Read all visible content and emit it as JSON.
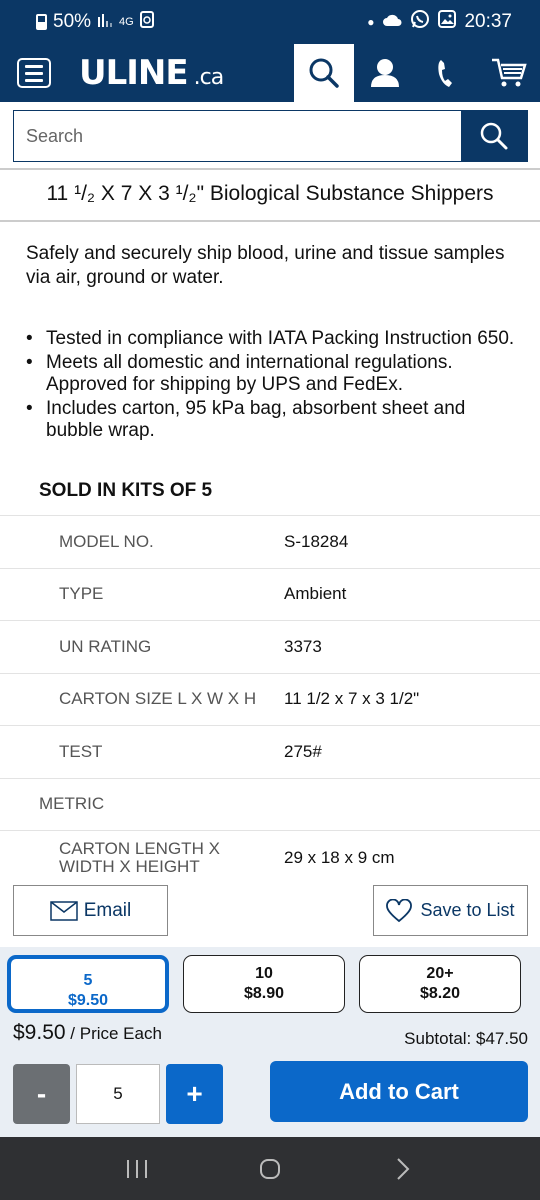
{
  "status_bar": {
    "battery": "50%",
    "signal": "4G",
    "time": "20:37",
    "icons": [
      "battery-icon",
      "signal-icon",
      "lte-icon",
      "notification-icon",
      "dot-icon",
      "cloud-icon",
      "whatsapp-icon",
      "gallery-icon"
    ]
  },
  "header": {
    "logo_main": "ULINE",
    "logo_suffix": ".ca",
    "icons": [
      "menu-icon",
      "search-icon",
      "account-icon",
      "phone-icon",
      "cart-icon"
    ],
    "brand_color": "#0b3765"
  },
  "search": {
    "placeholder": "Search"
  },
  "product": {
    "title": "11 ¹/₂ X 7 X 3 ¹/₂\" Biological Substance Shippers",
    "intro": "Safely and securely ship blood, urine and tissue samples via air, ground or water.",
    "bullets": [
      "Tested in compliance with IATA Packing Instruction 650.",
      "Meets all domestic and international regulations. Approved for shipping by UPS and FedEx.",
      "Includes carton, 95 kPa bag, absorbent sheet and bubble wrap."
    ],
    "sold_in": "SOLD IN KITS OF 5"
  },
  "specs": {
    "rows": [
      {
        "label": "MODEL NO.",
        "value": "S-18284"
      },
      {
        "label": "TYPE",
        "value": "Ambient"
      },
      {
        "label": "UN RATING",
        "value": "3373"
      },
      {
        "label": "CARTON SIZE L X W X H",
        "value": "11 1/2 x 7 x 3 1/2\""
      },
      {
        "label": "TEST",
        "value": "275#"
      }
    ],
    "metric_heading": "METRIC",
    "metric_rows": [
      {
        "label": "CARTON LENGTH X WIDTH X HEIGHT",
        "value": "29 x 18 x 9 cm"
      }
    ]
  },
  "actions": {
    "email_label": "Email",
    "save_label": "Save to List"
  },
  "cart": {
    "tiers": [
      {
        "qty": "5",
        "price": "$9.50",
        "selected": true
      },
      {
        "qty": "10",
        "price": "$8.90",
        "selected": false
      },
      {
        "qty": "20+",
        "price": "$8.20",
        "selected": false
      }
    ],
    "price_each_value": "$9.50",
    "price_each_label": " / Price Each",
    "subtotal": "Subtotal: $47.50",
    "minus_label": "-",
    "quantity": "5",
    "plus_label": "+",
    "add_to_cart_label": "Add to Cart",
    "accent_color": "#0b68c9"
  },
  "nav_bar": {
    "icons": [
      "recent-apps-icon",
      "home-icon",
      "back-icon"
    ]
  }
}
